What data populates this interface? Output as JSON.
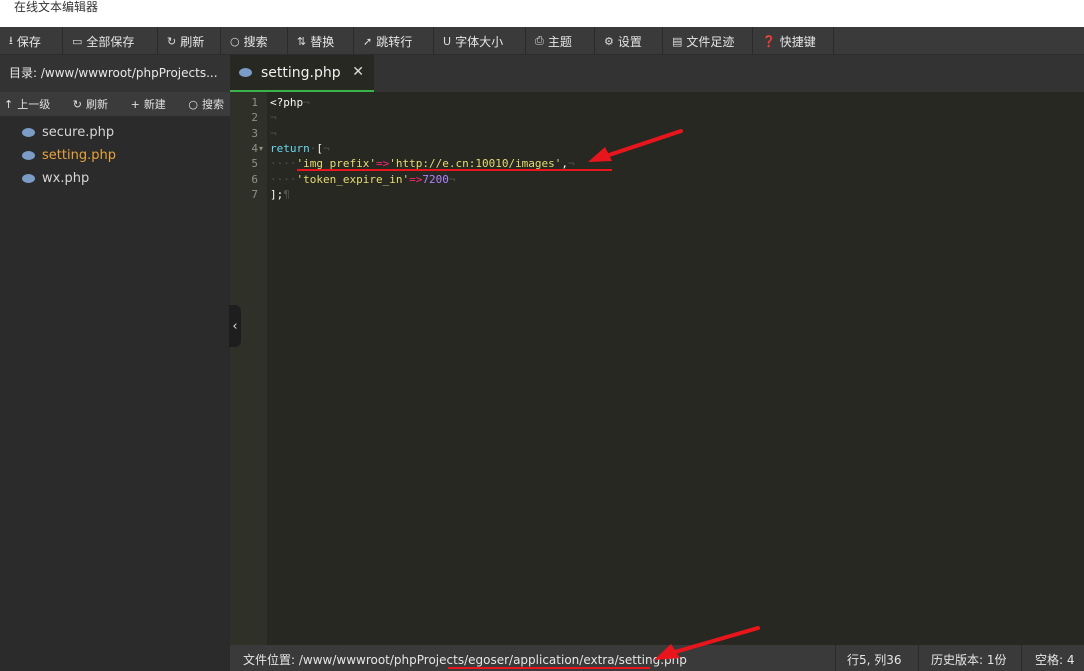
{
  "window": {
    "title": "在线文本编辑器"
  },
  "toolbar": {
    "items": [
      {
        "label": "保存",
        "icon": "save-icon"
      },
      {
        "label": "全部保存",
        "icon": "save-all-icon"
      },
      {
        "label": "刷新",
        "icon": "refresh-icon"
      },
      {
        "label": "搜索",
        "icon": "search-icon"
      },
      {
        "label": "替换",
        "icon": "replace-icon"
      },
      {
        "label": "跳转行",
        "icon": "goto-line-icon"
      },
      {
        "label": "字体大小",
        "icon": "font-size-icon"
      },
      {
        "label": "主题",
        "icon": "theme-icon"
      },
      {
        "label": "设置",
        "icon": "settings-icon"
      },
      {
        "label": "文件足迹",
        "icon": "history-icon"
      },
      {
        "label": "快捷键",
        "icon": "help-icon"
      }
    ]
  },
  "sidebar": {
    "directory_label": "目录: /www/wwwroot/phpProjects...",
    "tools": {
      "up": "上一级",
      "refresh": "刷新",
      "new": "新建",
      "search": "搜索"
    },
    "files": [
      {
        "name": "secure.php",
        "active": false
      },
      {
        "name": "setting.php",
        "active": true
      },
      {
        "name": "wx.php",
        "active": false
      }
    ]
  },
  "tabs": [
    {
      "label": "setting.php",
      "close": "✕"
    }
  ],
  "editor": {
    "line_numbers": [
      "1",
      "2",
      "3",
      "4",
      "5",
      "6",
      "7"
    ],
    "lines": {
      "l1": "<?php",
      "l4_kw": "return",
      "l4_rest": "[",
      "l5_key": "'img_prefix'",
      "l5_op": "=>",
      "l5_val": "'http://e.cn:10010/images'",
      "l5_end": ",",
      "l6_key": "'token_expire_in'",
      "l6_op": "=>",
      "l6_val": "7200",
      "l7": "];"
    },
    "invisibles": {
      "eol": "¬",
      "dots": "····",
      "para": "¶"
    }
  },
  "statusbar": {
    "file_path": "文件位置: /www/wwwroot/phpProjects/egoser/application/extra/setting.php",
    "cursor": "行5, 列36",
    "history": "历史版本: 1份",
    "indent": "空格: 4"
  },
  "colors": {
    "editor_bg": "#272822",
    "accent_tab": "#3bb34a",
    "active_file": "#e8a33d",
    "keyword": "#66d9ef",
    "string": "#e6db74",
    "operator": "#f92672",
    "number": "#ae81ff",
    "annotation": "#e8161c"
  }
}
